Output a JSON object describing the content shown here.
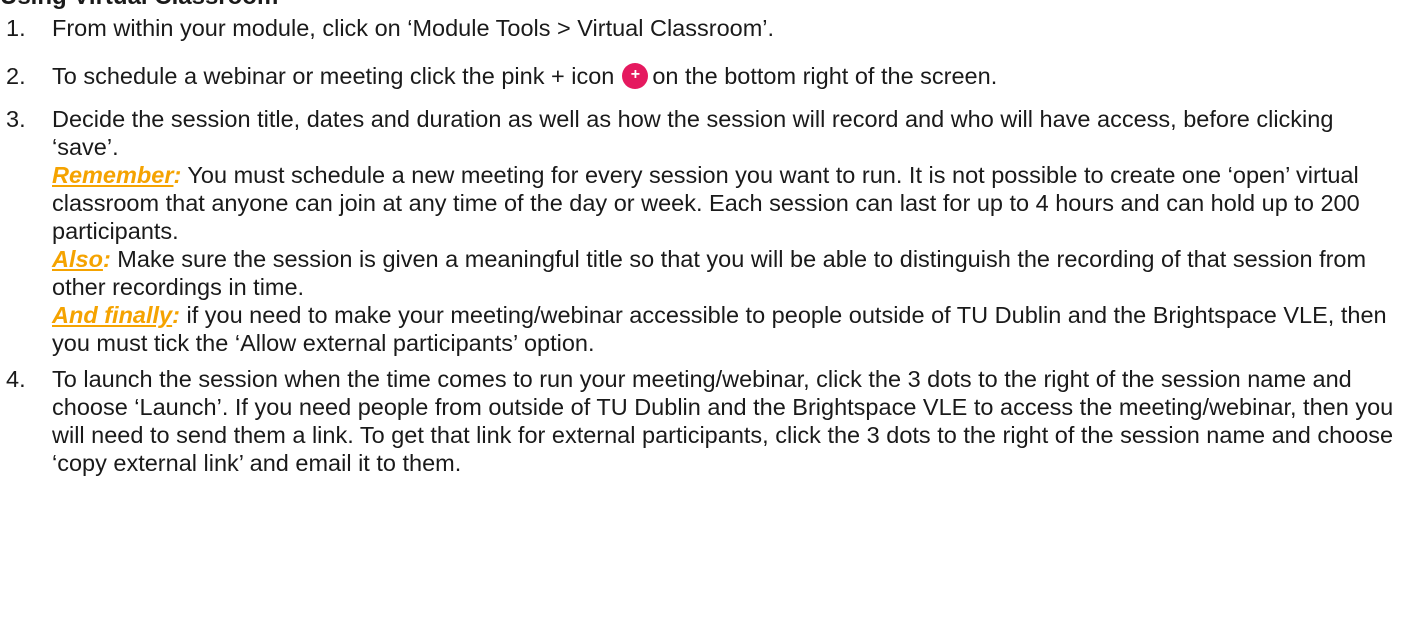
{
  "heading_fragment": "Using Virtual Classroom",
  "steps": [
    {
      "number": "1.",
      "text": "From within your module, click on ‘Module Tools > Virtual Classroom’."
    },
    {
      "number": "2.",
      "text_before_icon": "To schedule a webinar or meeting click the pink + icon",
      "icon": "pink-plus-icon",
      "icon_glyph": "+",
      "text_after_icon": "on the bottom right of the screen."
    },
    {
      "number": "3.",
      "text": "Decide the session title, dates and duration as well as how the session will record and who will have access, before clicking ‘save’.",
      "notes": [
        {
          "label": "Remember",
          "colon": ":",
          "text": " You must schedule a new meeting for every session you want to run. It is not possible to create one ‘open’ virtual classroom that anyone can join at any time of the day or week. Each session can last for up to 4 hours and can hold up to 200 participants."
        },
        {
          "label": "Also",
          "colon": ":",
          "text": " Make sure the session is given a meaningful title so that you will be able to distinguish the recording of that session from other recordings in time."
        },
        {
          "label": "And finally",
          "colon": ":",
          "text": " if you need to make your meeting/webinar accessible to people outside of TU Dublin and the Brightspace VLE, then you must tick the ‘Allow external participants’ option."
        }
      ]
    },
    {
      "number": "4.",
      "text": "To launch the session when the time comes to run your meeting/webinar, click the 3 dots to the right of the session name and choose ‘Launch’. If you need people from outside of TU Dublin and the Brightspace VLE to access the meeting/webinar, then you will need to send them a link. To get that link for external participants, click the 3 dots to the right of the session name and choose ‘copy external link’ and email it to them."
    }
  ],
  "colors": {
    "text": "#1a1a1a",
    "accent_orange": "#f5a300",
    "icon_pink": "#e5195f"
  }
}
